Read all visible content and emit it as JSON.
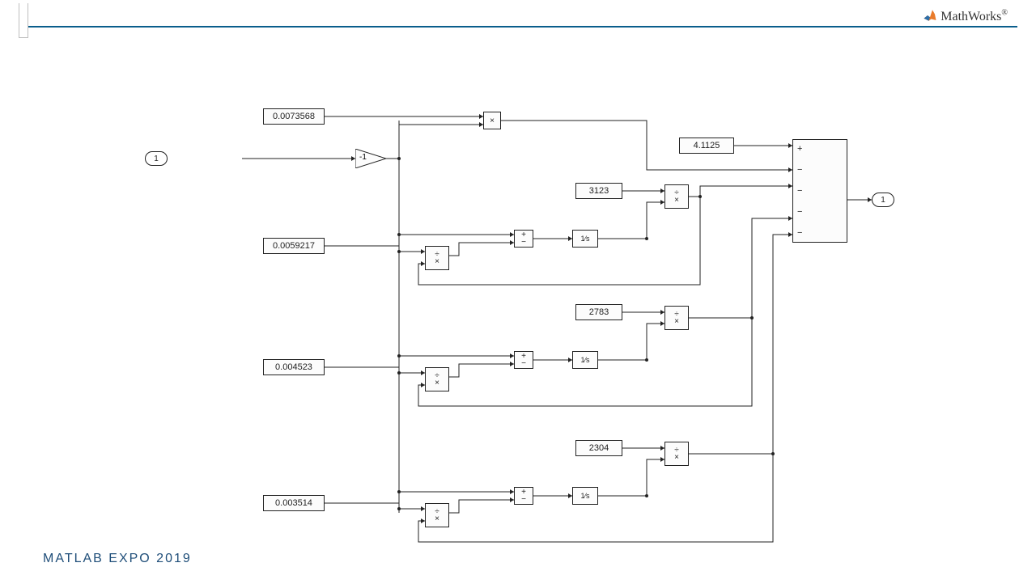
{
  "brand": "MathWorks",
  "footer": "MATLAB EXPO 2019",
  "inport": "1",
  "outport": "1",
  "gain": "-1",
  "constants": {
    "c_top": "0.0073568",
    "c_a": "0.0059217",
    "c_b": "0.004523",
    "c_c": "0.003514",
    "k_out": "4.1125",
    "k_a": "3123",
    "k_b": "2783",
    "k_c": "2304"
  },
  "integrator": "1⁄s",
  "sum_plus": "+",
  "sum_minus": "−",
  "div_top": "÷",
  "mul_sym": "×"
}
